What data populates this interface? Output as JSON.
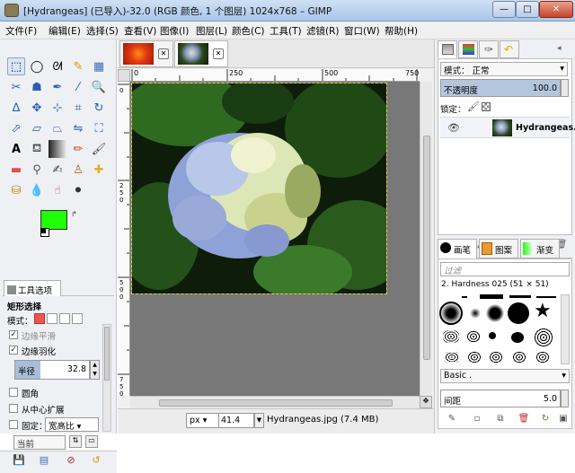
{
  "window": {
    "title": "[Hydrangeas] (已导入)-32.0 (RGB 颜色, 1 个图层) 1024x768 – GIMP",
    "minimize": "—",
    "maximize": "□",
    "close": "✕"
  },
  "menubar": [
    "文件(F)",
    "编辑(E)",
    "选择(S)",
    "查看(V)",
    "图像(I)",
    "图层(L)",
    "颜色(C)",
    "工具(T)",
    "滤镜(R)",
    "窗口(W)",
    "帮助(H)"
  ],
  "toolbox": {
    "tools": [
      "rect-select",
      "ellipse-select",
      "free-select",
      "fuzzy-select",
      "select-by-color",
      "scissors",
      "foreground-select",
      "paths",
      "color-picker",
      "zoom",
      "measure",
      "move",
      "align",
      "crop",
      "rotate",
      "scale",
      "shear",
      "perspective",
      "flip",
      "cage",
      "text",
      "bucket-fill",
      "blend",
      "pencil",
      "paintbrush",
      "eraser",
      "airbrush",
      "ink",
      "clone",
      "heal",
      "perspective-clone",
      "blur",
      "smudge",
      "dodge"
    ],
    "colors": {
      "foreground": "#1eff08",
      "background": "#ffffff"
    }
  },
  "tool_options": {
    "tab_label": "工具选项",
    "title": "矩形选择",
    "mode_label": "模式：",
    "antialias_label": "边缘平滑",
    "feather_label": "边缘羽化",
    "radius_label": "半径",
    "radius_value": "32.8",
    "rounded_label": "圆角",
    "expand_center_label": "从中心扩展",
    "fixed_label": "固定：",
    "fixed_value": "宽高比",
    "current_value": "当前"
  },
  "image": {
    "tabs": [
      "flower-red",
      "hydrangeas"
    ],
    "ruler_h": [
      "0",
      "250",
      "500",
      "750"
    ],
    "ruler_v": [
      "0",
      "2",
      "5",
      "0",
      "5",
      "0",
      "0",
      "7",
      "5",
      "0"
    ],
    "unit": "px",
    "zoom": "41.4",
    "status": "Hydrangeas.jpg (7.4 MB)"
  },
  "layers": {
    "mode_label": "模式：",
    "mode_value": "正常",
    "opacity_label": "不透明度",
    "opacity_value": "100.0",
    "lock_label": "锁定：",
    "layer_name": "Hydrangeas.jp"
  },
  "brushes": {
    "tabs": [
      "画笔",
      "图案",
      "渐变"
    ],
    "filter_placeholder": "过滤",
    "current_brush": "2. Hardness 025 (51 × 51)",
    "category": "Basic .",
    "spacing_label": "间距",
    "spacing_value": "5.0"
  },
  "accent": "#316ac5"
}
